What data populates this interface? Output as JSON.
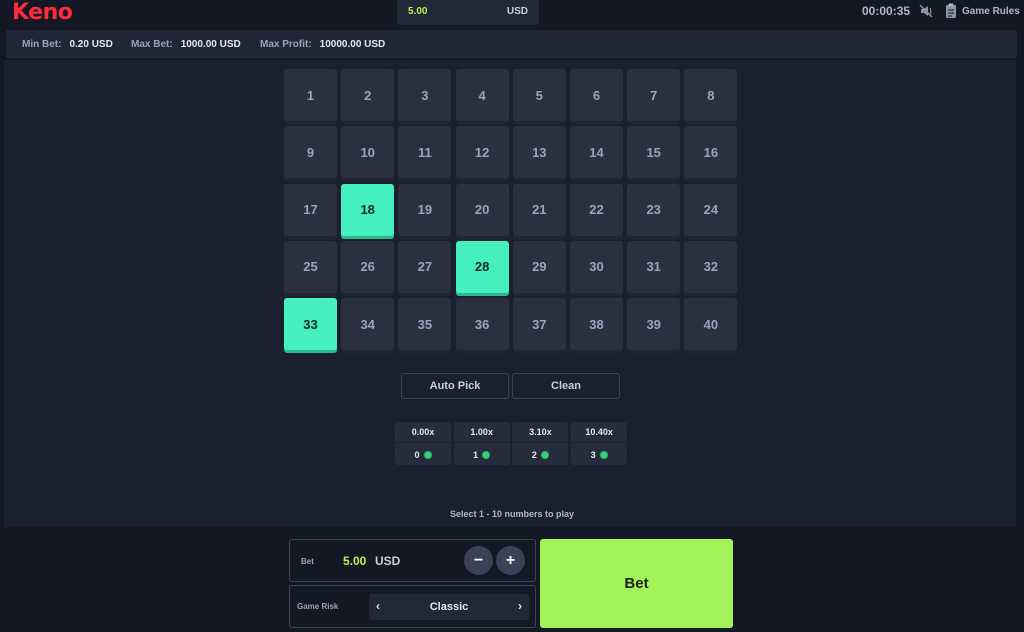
{
  "app": {
    "logo": "Keno"
  },
  "header": {
    "balance": "5.00",
    "currency": "USD",
    "timer": "00:00:35",
    "rules_label": "Game Rules",
    "icons": [
      "mute-icon",
      "rules-icon"
    ]
  },
  "limits": {
    "min_label": "Min Bet:",
    "min_value": "0.20 USD",
    "max_label": "Max Bet:",
    "max_value": "1000.00 USD",
    "profit_label": "Max Profit:",
    "profit_value": "10000.00 USD"
  },
  "board": {
    "numbers": [
      "1",
      "2",
      "3",
      "4",
      "5",
      "6",
      "7",
      "8",
      "9",
      "10",
      "11",
      "12",
      "13",
      "14",
      "15",
      "16",
      "17",
      "18",
      "19",
      "20",
      "21",
      "22",
      "23",
      "24",
      "25",
      "26",
      "27",
      "28",
      "29",
      "30",
      "31",
      "32",
      "33",
      "34",
      "35",
      "36",
      "37",
      "38",
      "39",
      "40"
    ],
    "selected": [
      18,
      28,
      33
    ]
  },
  "actions": {
    "auto_pick": "Auto Pick",
    "clean": "Clean"
  },
  "payouts": [
    {
      "multiplier": "0.00x",
      "hits": "0"
    },
    {
      "multiplier": "1.00x",
      "hits": "1"
    },
    {
      "multiplier": "3.10x",
      "hits": "2"
    },
    {
      "multiplier": "10.40x",
      "hits": "3"
    }
  ],
  "instruction": "Select 1 - 10 numbers to play",
  "bet": {
    "label": "Bet",
    "value": "5.00",
    "currency": "USD",
    "minus": "−",
    "plus": "+"
  },
  "risk": {
    "label": "Game Risk",
    "value": "Classic",
    "prev": "‹",
    "next": "›"
  },
  "bet_button": "Bet",
  "colors": {
    "accent": "#45f0be",
    "bet_button": "#a3f25a",
    "balance": "#b4f64a",
    "logo": "#ff2a3d",
    "gem": "#39d27a"
  }
}
